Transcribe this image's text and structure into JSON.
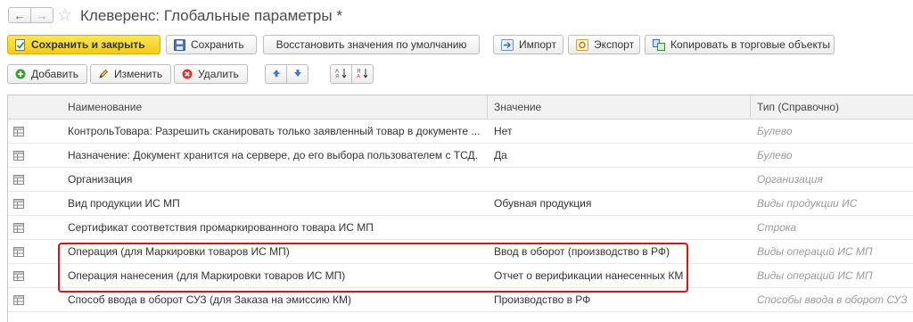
{
  "window": {
    "title": "Клеверенс: Глобальные параметры *"
  },
  "toolbar1": {
    "save_close": "Сохранить и закрыть",
    "save": "Сохранить",
    "restore": "Восстановить значения по умолчанию",
    "import": "Импорт",
    "export": "Экспорт",
    "copy": "Копировать в торговые объекты"
  },
  "toolbar2": {
    "add": "Добавить",
    "edit": "Изменить",
    "delete": "Удалить"
  },
  "table": {
    "headers": [
      "Наименование",
      "Значение",
      "Тип (Справочно)"
    ],
    "rows": [
      {
        "name": "КонтрольТовара: Разрешить сканировать только заявленный товар в документе ...",
        "value": "Нет",
        "type": "Булево"
      },
      {
        "name": "Назначение: Документ хранится на сервере, до его выбора пользователем с ТСД.",
        "value": "Да",
        "type": "Булево"
      },
      {
        "name": "Организация",
        "value": "",
        "type": "Организация"
      },
      {
        "name": "Вид продукции ИС МП",
        "value": "Обувная продукция",
        "type": "Виды продукции ИС"
      },
      {
        "name": "Сертификат соответствия промаркированного товара ИС МП",
        "value": "",
        "type": "Строка"
      },
      {
        "name": "Операция (для Маркировки товаров ИС МП)",
        "value": "Ввод в оборот (производство в РФ)",
        "type": "Виды операций ИС МП"
      },
      {
        "name": "Операция нанесения (для Маркировки товаров ИС МП)",
        "value": "Отчет о верификации нанесенных КМ",
        "type": "Виды операций ИС МП"
      },
      {
        "name": "Способ ввода в оборот СУЗ (для Заказа на эмиссию КМ)",
        "value": "Производство в РФ",
        "type": "Способы ввода в оборот СУЗ"
      }
    ]
  },
  "colors": {
    "primary_button": "#f1cc14",
    "highlight_border": "#e01010",
    "type_text": "#9a9a9a"
  }
}
